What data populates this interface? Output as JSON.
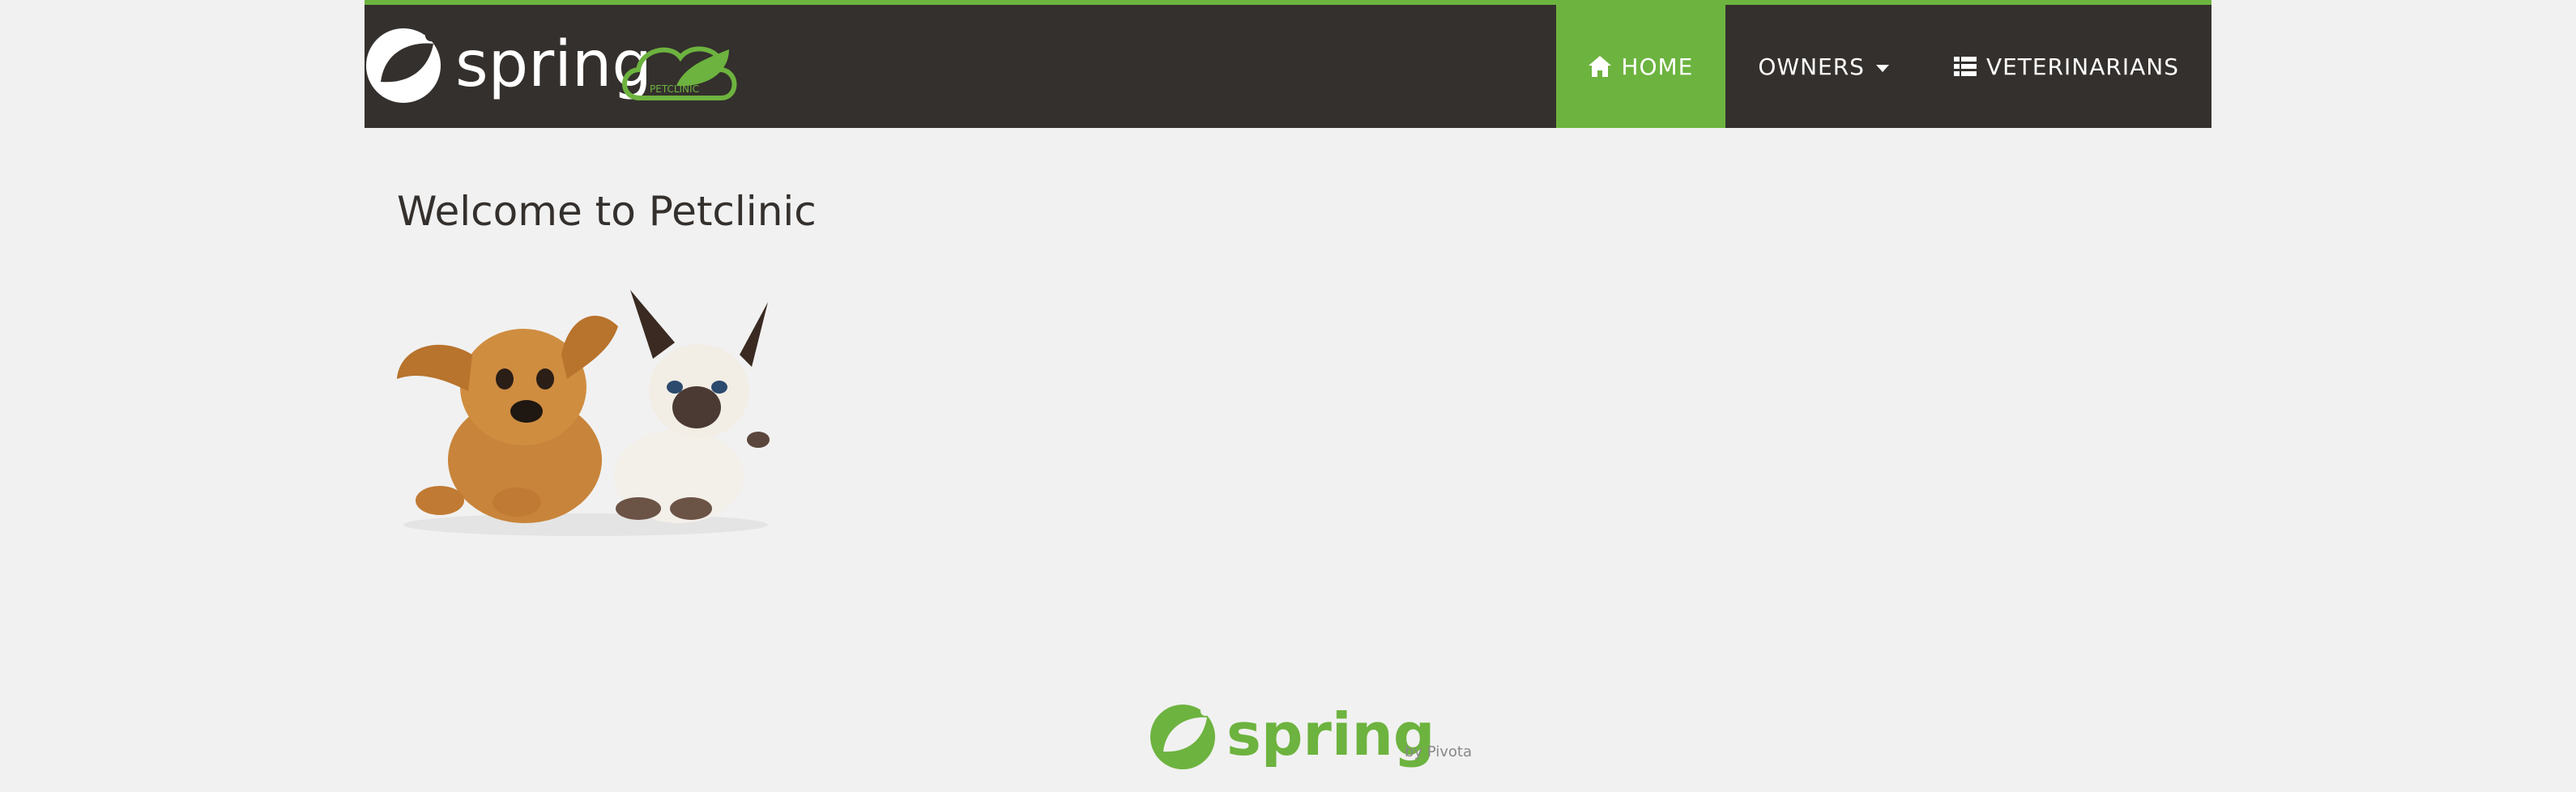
{
  "header": {
    "brand_text": "spring",
    "brand_badge": "PETCLINIC",
    "colors": {
      "bar": "#34302d",
      "accent": "#6db33f"
    }
  },
  "nav": {
    "home": {
      "icon": "home-icon",
      "label": "HOME",
      "active": true
    },
    "owners": {
      "label": "OWNERS",
      "icon": "caret-down-icon"
    },
    "vets": {
      "icon": "list-icon",
      "label": "VETERINARIANS"
    }
  },
  "main": {
    "title": "Welcome to Petclinic",
    "image": "dog-and-cat-picture"
  },
  "footer": {
    "brand_text": "spring",
    "byline": "by Pivotal."
  }
}
